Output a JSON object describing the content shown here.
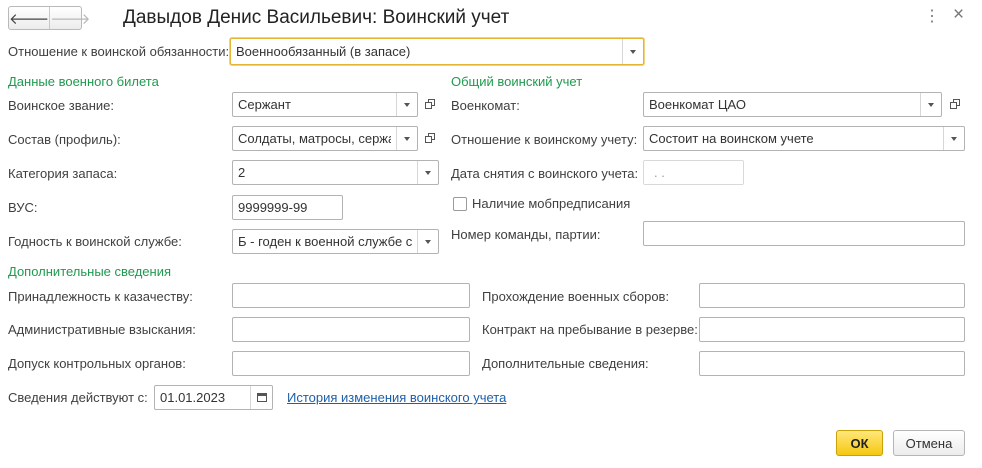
{
  "header": {
    "back_icon": "arrow-left-icon",
    "forward_icon": "arrow-right-icon",
    "title": "Давыдов Денис Васильевич: Воинский учет",
    "more_glyph": "⋮",
    "close_glyph": "×"
  },
  "attitude": {
    "label": "Отношение к воинской обязанности:",
    "value": "Военнообязанный (в запасе)"
  },
  "military_id": {
    "section_title": "Данные военного билета",
    "rank": {
      "label": "Воинское звание:",
      "value": "Сержант"
    },
    "composition": {
      "label": "Состав (профиль):",
      "value": "Солдаты, матросы, сержанты"
    },
    "reserve_category": {
      "label": "Категория запаса:",
      "value": "2"
    },
    "vus": {
      "label": "ВУС:",
      "value": "9999999-99"
    },
    "fitness": {
      "label": "Годность к воинской службе:",
      "value": "Б - годен к военной службе с незначительными ограничениями"
    }
  },
  "general": {
    "section_title": "Общий воинский учет",
    "commissariat": {
      "label": "Военкомат:",
      "value": "Военкомат ЦАО"
    },
    "registration": {
      "label": "Отношение к воинскому учету:",
      "value": "Состоит на воинском учете"
    },
    "removal_date": {
      "label": "Дата снятия с воинского учета:",
      "value": " .  ."
    },
    "mob_order": {
      "label": "Наличие мобпредписания",
      "checked": false
    },
    "team_number": {
      "label": "Номер команды, партии:",
      "value": ""
    }
  },
  "additional": {
    "section_title": "Дополнительные сведения",
    "cossack": {
      "label": "Принадлежность к казачеству:",
      "value": ""
    },
    "penalties": {
      "label": "Административные взыскания:",
      "value": ""
    },
    "clearance": {
      "label": "Допуск контрольных органов:",
      "value": ""
    },
    "training": {
      "label": "Прохождение военных сборов:",
      "value": ""
    },
    "reserve_contract": {
      "label": "Контракт на пребывание в резерве:",
      "value": ""
    },
    "extra": {
      "label": "Дополнительные сведения:",
      "value": ""
    }
  },
  "effective": {
    "label": "Сведения действуют с:",
    "value": "01.01.2023",
    "history_link": "История изменения воинского учета"
  },
  "footer": {
    "ok_label": "ОК",
    "cancel_label": "Отмена"
  },
  "colors": {
    "section": "#1f9a4e",
    "focus_border": "#e4b532",
    "ok_button": "#f6c812",
    "link": "#1d5fa8"
  }
}
